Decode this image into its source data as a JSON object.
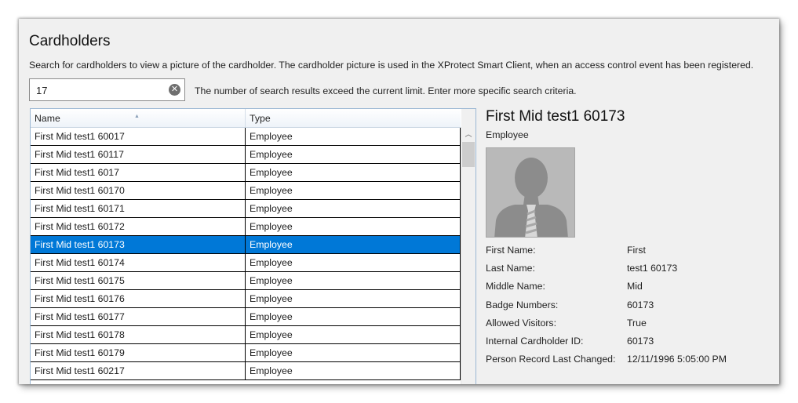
{
  "page": {
    "title": "Cardholders",
    "description": "Search for cardholders to view a picture of the cardholder. The cardholder picture is used in the XProtect Smart Client, when an access control event has been registered."
  },
  "search": {
    "value": "17",
    "clear_icon": "clear-circle-icon",
    "limit_message": "The number of search results exceed the current limit. Enter more specific search criteria."
  },
  "grid": {
    "columns": [
      "Name",
      "Type"
    ],
    "sort_column": "Name",
    "sort_direction": "ascending",
    "selected_index": 6,
    "rows": [
      {
        "name": "First Mid test1 60017",
        "type": "Employee"
      },
      {
        "name": "First Mid test1 60117",
        "type": "Employee"
      },
      {
        "name": "First Mid test1 6017",
        "type": "Employee"
      },
      {
        "name": "First Mid test1 60170",
        "type": "Employee"
      },
      {
        "name": "First Mid test1 60171",
        "type": "Employee"
      },
      {
        "name": "First Mid test1 60172",
        "type": "Employee"
      },
      {
        "name": "First Mid test1 60173",
        "type": "Employee"
      },
      {
        "name": "First Mid test1 60174",
        "type": "Employee"
      },
      {
        "name": "First Mid test1 60175",
        "type": "Employee"
      },
      {
        "name": "First Mid test1 60176",
        "type": "Employee"
      },
      {
        "name": "First Mid test1 60177",
        "type": "Employee"
      },
      {
        "name": "First Mid test1 60178",
        "type": "Employee"
      },
      {
        "name": "First Mid test1 60179",
        "type": "Employee"
      },
      {
        "name": "First Mid test1 60217",
        "type": "Employee"
      }
    ]
  },
  "details": {
    "name": "First Mid test1 60173",
    "type": "Employee",
    "photo": "person-silhouette-icon",
    "fields": [
      {
        "label": "First Name:",
        "value": "First"
      },
      {
        "label": "Last Name:",
        "value": "test1 60173"
      },
      {
        "label": "Middle Name:",
        "value": "Mid"
      },
      {
        "label": "Badge Numbers:",
        "value": "60173"
      },
      {
        "label": "Allowed Visitors:",
        "value": "True"
      },
      {
        "label": "Internal Cardholder ID:",
        "value": "60173"
      },
      {
        "label": "Person Record Last Changed:",
        "value": "12/11/1996 5:05:00 PM"
      }
    ]
  },
  "colors": {
    "selection": "#0078d7",
    "panel_background": "#f0f0f0"
  }
}
